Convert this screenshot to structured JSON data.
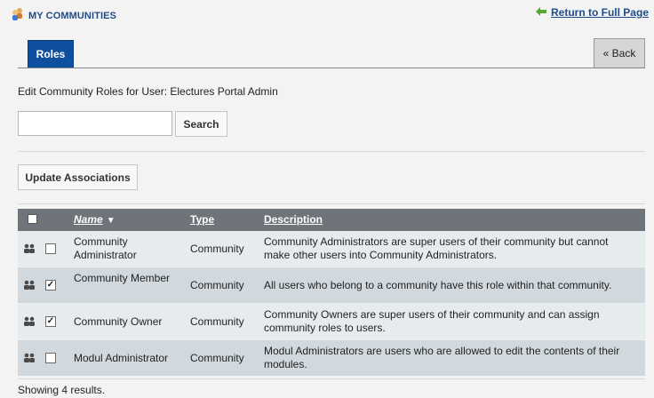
{
  "header": {
    "title": "MY COMMUNITIES",
    "return_link": "Return to Full Page"
  },
  "tabs": {
    "roles": "Roles"
  },
  "back_button": "« Back",
  "edit_label": "Edit Community Roles for User: Electures Portal Admin",
  "search": {
    "value": "",
    "button": "Search"
  },
  "update_button": "Update Associations",
  "table": {
    "columns": {
      "name": "Name",
      "type": "Type",
      "description": "Description"
    },
    "rows": [
      {
        "name": "Community Administrator",
        "type": "Community",
        "checked": false,
        "description": "Community Administrators are super users of their community but cannot make other users into Community Administrators."
      },
      {
        "name": "Community Member",
        "type": "Community",
        "checked": true,
        "description": "All users who belong to a community have this role within that community."
      },
      {
        "name": "Community Owner",
        "type": "Community",
        "checked": true,
        "description": "Community Owners are super users of their community and can assign community roles to users."
      },
      {
        "name": "Modul Administrator",
        "type": "Community",
        "checked": false,
        "description": "Modul Administrators are users who are allowed to edit the contents of their modules."
      }
    ]
  },
  "footer": "Showing 4 results.",
  "colors": {
    "accent": "#0f4fa0",
    "link": "#1f4d8b",
    "table_header": "#6e7479"
  }
}
